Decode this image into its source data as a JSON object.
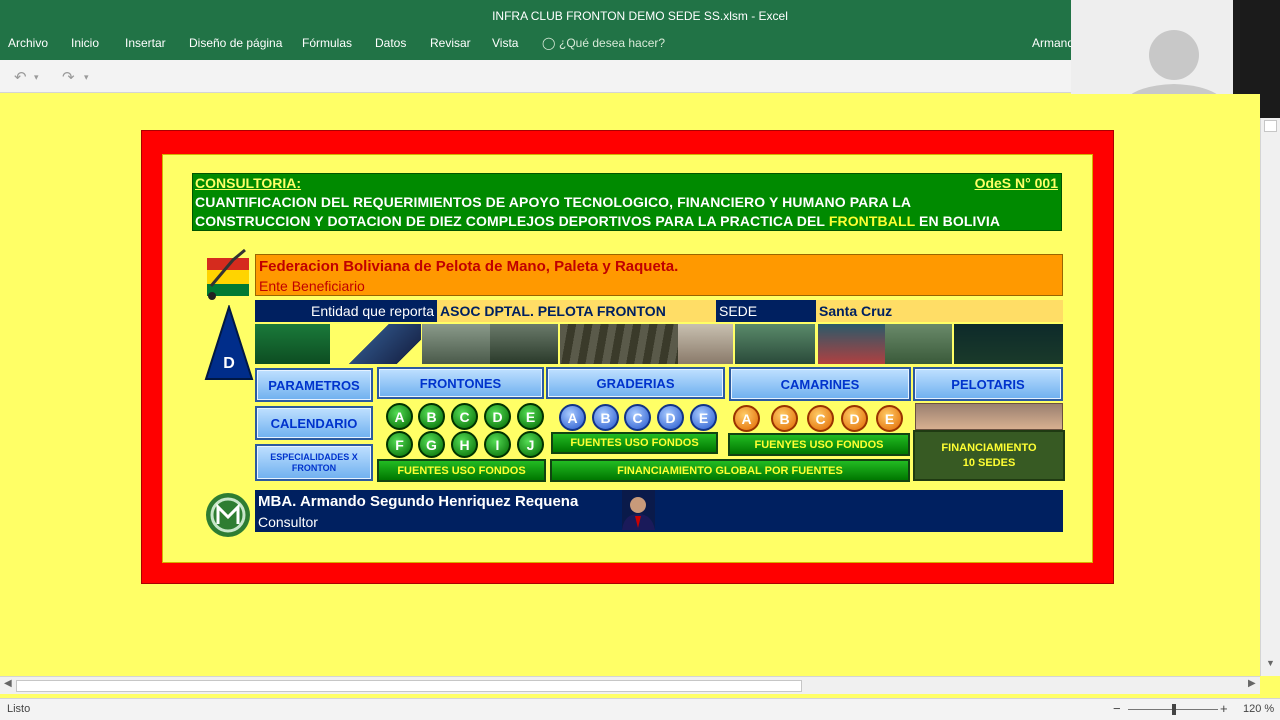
{
  "window": {
    "title": "INFRA CLUB FRONTON DEMO SEDE SS.xlsm - Excel"
  },
  "ribbon": {
    "tabs": [
      "Archivo",
      "Inicio",
      "Insertar",
      "Diseño de página",
      "Fórmulas",
      "Datos",
      "Revisar",
      "Vista"
    ],
    "tell_me": "¿Qué desea hacer?",
    "user": "Armand"
  },
  "banner": {
    "consultoria": "CONSULTORIA:",
    "odes": "OdeS N° 001",
    "line1": "CUANTIFICACION DEL REQUERIMIENTOS DE APOYO TECNOLOGICO, FINANCIERO Y HUMANO PARA LA",
    "line2_a": "CONSTRUCCION Y DOTACION DE DIEZ COMPLEJOS DEPORTIVOS PARA LA PRACTICA DEL ",
    "line2_highlight": "FRONTBALL",
    "line2_b": " EN BOLIVIA"
  },
  "federation": {
    "name": "Federacion Boliviana de Pelota de Mano, Paleta y Raqueta.",
    "role": "Ente Beneficiario"
  },
  "report": {
    "entity_label": "Entidad que reporta",
    "entity_value": "ASOC DPTAL. PELOTA FRONTON",
    "sede_label": "SEDE",
    "sede_value": "Santa Cruz"
  },
  "logo_d": "D",
  "nav": {
    "parametros": "PARAMETROS",
    "calendario": "CALENDARIO",
    "especialidades": "ESPECIALIDADES X FRONTON",
    "frontones": "FRONTONES",
    "graderias": "GRADERIAS",
    "camarines": "CAMARINES",
    "pelotaris": "PELOTARIS"
  },
  "frontones_circles": [
    "A",
    "B",
    "C",
    "D",
    "E",
    "F",
    "G",
    "H",
    "I",
    "J"
  ],
  "graderias_circles": [
    "A",
    "B",
    "C",
    "D",
    "E"
  ],
  "camarines_circles": [
    "A",
    "B",
    "C",
    "D",
    "E"
  ],
  "funds": {
    "frontones": "FUENTES USO FONDOS",
    "graderias": "FUENTES USO FONDOS",
    "camarines": "FUENYES USO FONDOS",
    "global": "FINANCIAMIENTO GLOBAL POR FUENTES",
    "sedes": "FINANCIAMIENTO 10 SEDES"
  },
  "consultant": {
    "name": "MBA. Armando Segundo Henriquez Requena",
    "role": "Consultor"
  },
  "status": {
    "ready": "Listo",
    "zoom": "120 %"
  },
  "colors": {
    "excel_green": "#217346",
    "sheet_yellow": "#ffff66",
    "frame_red": "#ff0000",
    "banner_green": "#008a00",
    "navy": "#002060",
    "orange": "#ff9900"
  }
}
